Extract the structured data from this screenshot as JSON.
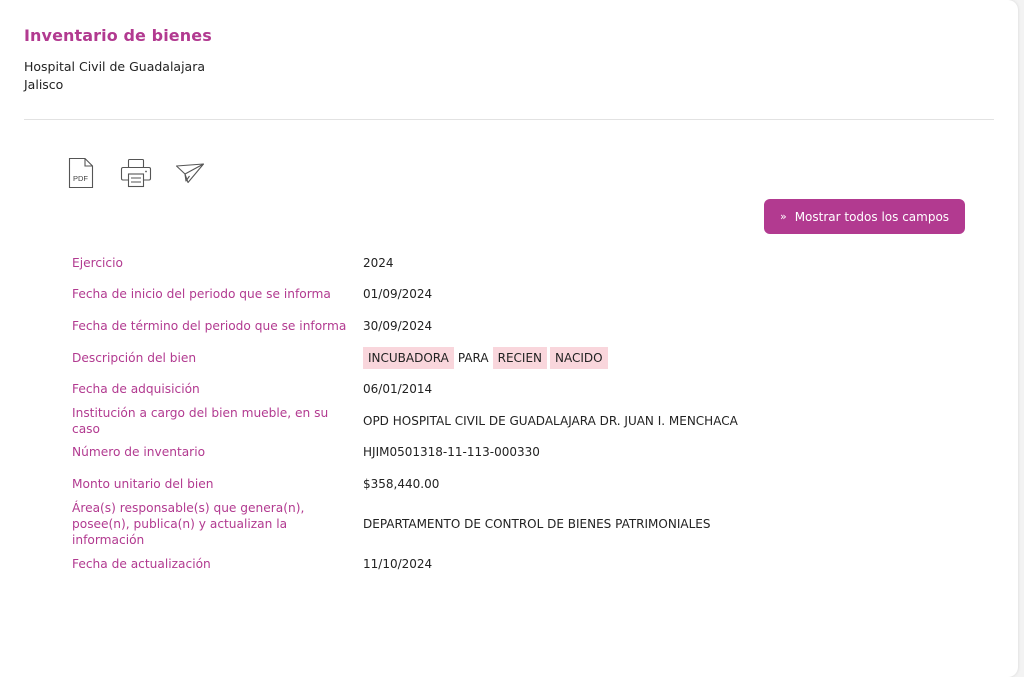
{
  "header": {
    "title": "Inventario de bienes",
    "org_lines": [
      "Hospital Civil de Guadalajara",
      "Jalisco"
    ]
  },
  "toolbar": {
    "pdf_text": "PDF",
    "icons": [
      "pdf-icon",
      "print-icon",
      "send-icon"
    ]
  },
  "show_all": {
    "label": "Mostrar todos los campos",
    "icon": "chevron-double-down-icon"
  },
  "fields": [
    {
      "label": "Ejercicio",
      "value": "2024"
    },
    {
      "label": "Fecha de inicio del periodo que se informa",
      "value": "01/09/2024"
    },
    {
      "label": "Fecha de término del periodo que se informa",
      "value": "30/09/2024"
    },
    {
      "label": "Descripción del bien",
      "chips": [
        {
          "text": "INCUBADORA",
          "highlight": true
        },
        {
          "text": "PARA",
          "highlight": false
        },
        {
          "text": "RECIEN",
          "highlight": true
        },
        {
          "text": "NACIDO",
          "highlight": true
        }
      ]
    },
    {
      "label": "Fecha de adquisición",
      "value": "06/01/2014"
    },
    {
      "label": "Institución a cargo del bien mueble, en su caso",
      "value": "OPD HOSPITAL CIVIL DE GUADALAJARA DR. JUAN I. MENCHACA"
    },
    {
      "label": "Número de inventario",
      "value": "HJIM0501318-11-113-000330"
    },
    {
      "label": "Monto unitario del bien",
      "value": "$358,440.00"
    },
    {
      "label": "Área(s) responsable(s) que genera(n), posee(n), publica(n) y actualizan la información",
      "value": "DEPARTAMENTO DE CONTROL DE BIENES PATRIMONIALES"
    },
    {
      "label": "Fecha de actualización",
      "value": "11/10/2024"
    }
  ],
  "colors": {
    "accent": "#b23a90",
    "highlight": "#f9d6dc"
  }
}
